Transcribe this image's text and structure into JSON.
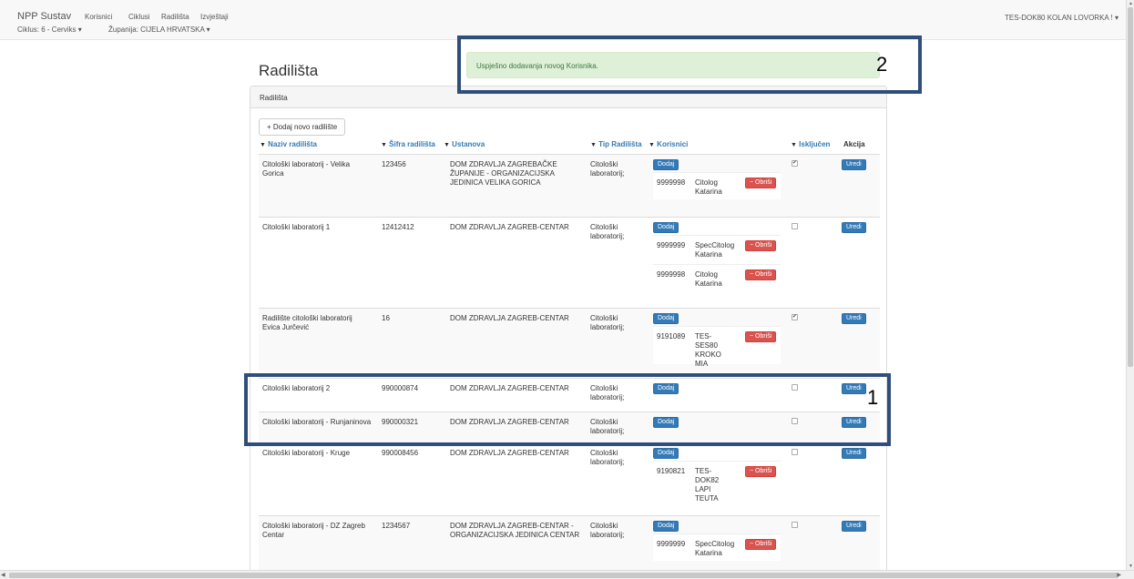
{
  "navbar": {
    "brand": "NPP Sustav",
    "links": [
      "Korisnici",
      "Ciklusi",
      "Radilišta",
      "Izvještaji"
    ],
    "ciklus": "Ciklus: 6 - Cerviks",
    "zupanija": "Županija: CIJELA HRVATSKA",
    "user": "TES-DOK80 KOLAN LOVORKA !"
  },
  "page_title": "Radilišta",
  "alert": "Uspješno dodavanja novog Korisnika.",
  "callouts": [
    "1",
    "2"
  ],
  "panel": {
    "heading": "Radilišta",
    "add_button": "+ Dodaj novo radilište"
  },
  "columns": {
    "naziv": "Naziv radilišta",
    "sifra": "Šifra radilišta",
    "ustanova": "Ustanova",
    "tip": "Tip Radilišta",
    "korisnici": "Korisnici",
    "iskljucen": "Isključen",
    "akcija": "Akcija"
  },
  "buttons": {
    "dodaj": "Dodaj",
    "uredi": "Uredi",
    "obrisi": "− Obriši"
  },
  "rows": [
    {
      "naziv": "Citološki laboratorij - Velika Gorica",
      "sifra": "123456",
      "ustanova": "DOM ZDRAVLJA ZAGREBAČKE ŽUPANIJE - ORGANIZACIJSKA JEDINICA VELIKA GORICA",
      "tip": "Citološki laboratorij;",
      "iskljucen": true,
      "korisnici": [
        {
          "id": "9999998",
          "name": "Citolog Katarina"
        }
      ]
    },
    {
      "naziv": "Citološki laboratorij 1",
      "sifra": "12412412",
      "ustanova": "DOM ZDRAVLJA ZAGREB-CENTAR",
      "tip": "Citološki laboratorij;",
      "iskljucen": false,
      "korisnici": [
        {
          "id": "9999999",
          "name": "SpecCitolog Katarina"
        },
        {
          "id": "9999998",
          "name": "Citolog Katarina"
        }
      ]
    },
    {
      "naziv": "Radilište citološki laboratorij Evica Jurčević",
      "sifra": "16",
      "ustanova": "DOM ZDRAVLJA ZAGREB-CENTAR",
      "tip": "Citološki laboratorij;",
      "iskljucen": true,
      "korisnici": [
        {
          "id": "9191089",
          "name": "TES-SES80 KROKO MIA"
        }
      ]
    },
    {
      "naziv": "Citološki laboratorij 2",
      "sifra": "990000874",
      "ustanova": "DOM ZDRAVLJA ZAGREB-CENTAR",
      "tip": "Citološki laboratorij;",
      "iskljucen": false,
      "korisnici": []
    },
    {
      "naziv": "Citološki laboratorij - Runjaninova",
      "sifra": "990000321",
      "ustanova": "DOM ZDRAVLJA ZAGREB-CENTAR",
      "tip": "Citološki laboratorij;",
      "iskljucen": false,
      "korisnici": []
    },
    {
      "naziv": "Citološki laboratorij - Kruge",
      "sifra": "990008456",
      "ustanova": "DOM ZDRAVLJA ZAGREB-CENTAR",
      "tip": "Citološki laboratorij;",
      "iskljucen": false,
      "korisnici": [
        {
          "id": "9190821",
          "name": "TES-DOK82 LAPI TEUTA"
        }
      ]
    },
    {
      "naziv": "Citološki laboratorij - DZ Zagreb Centar",
      "sifra": "1234567",
      "ustanova": "DOM ZDRAVLJA ZAGREB-CENTAR - ORGANIZACIJSKA JEDINICA CENTAR",
      "tip": "Citološki laboratorij;",
      "iskljucen": false,
      "korisnici": [
        {
          "id": "9999999",
          "name": "SpecCitolog Katarina"
        }
      ]
    }
  ]
}
